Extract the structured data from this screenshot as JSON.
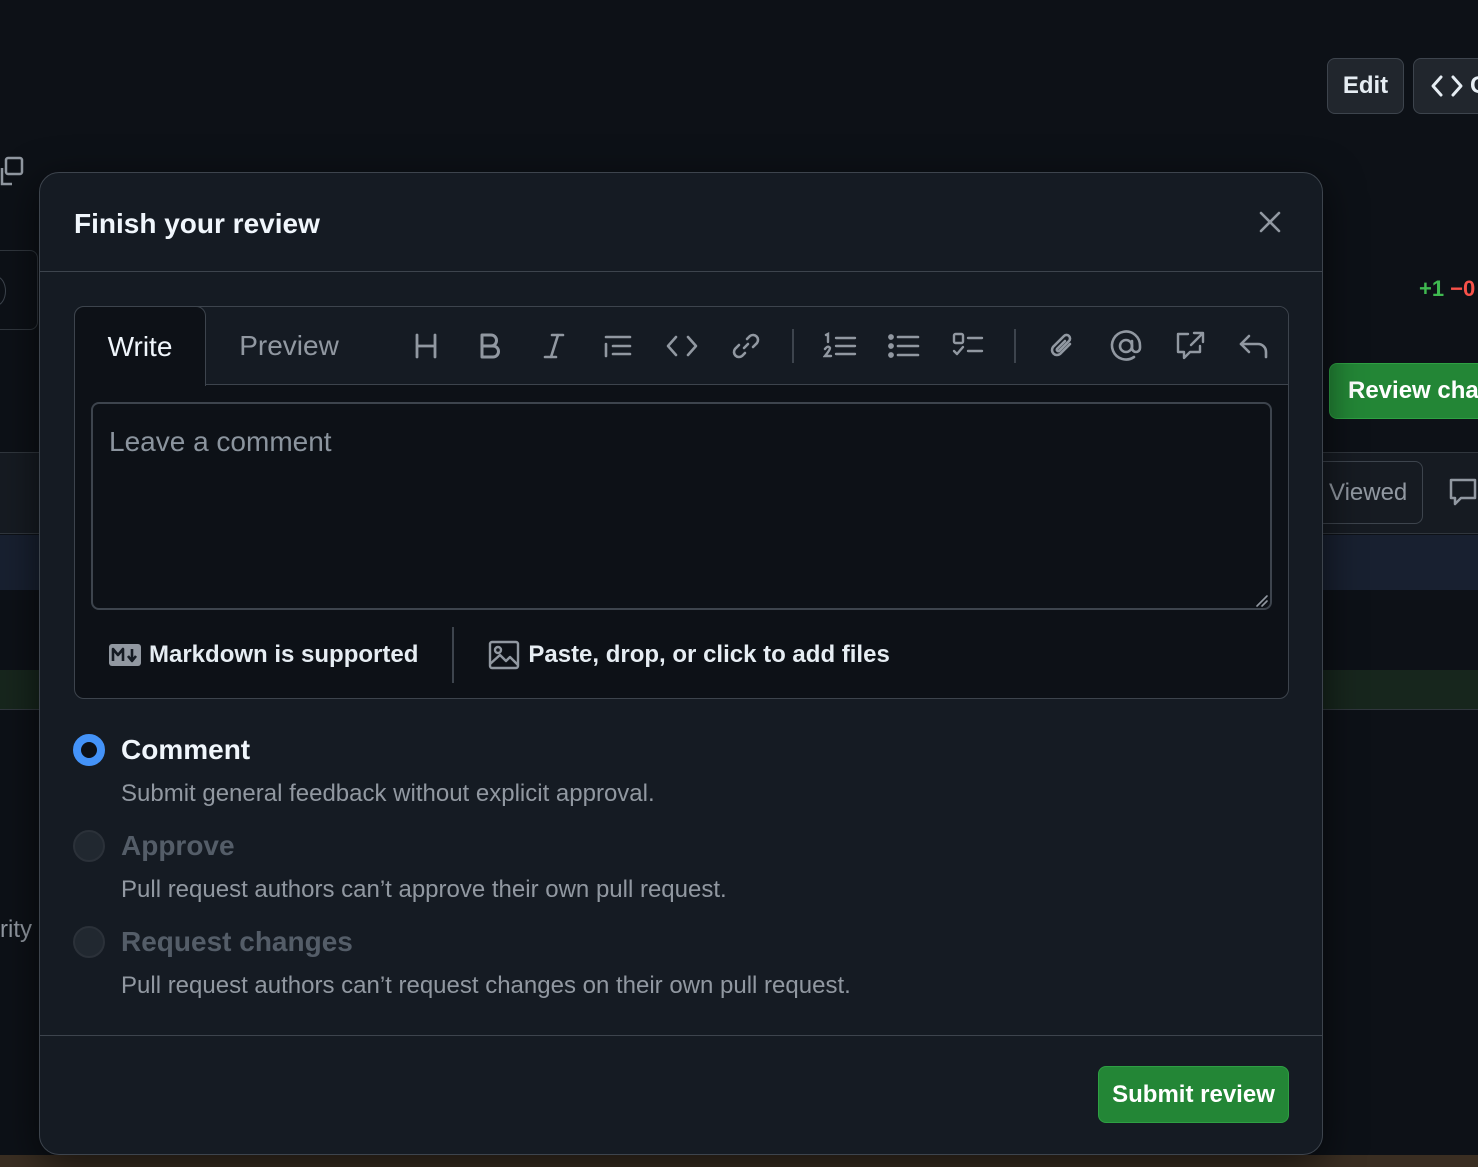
{
  "background": {
    "edit_label": "Edit",
    "code_label": "C",
    "diff_added": "+1",
    "diff_removed": "−0",
    "review_changes_label": "Review chan",
    "viewed_label": "Viewed",
    "side_text": "rity"
  },
  "dialog": {
    "title": "Finish your review",
    "close_icon": "x-icon",
    "tabs": {
      "write": "Write",
      "preview": "Preview"
    },
    "toolbar_icons": [
      "heading-icon",
      "bold-icon",
      "italic-icon",
      "quote-icon",
      "code-icon",
      "link-icon",
      "ordered-list-icon",
      "unordered-list-icon",
      "task-list-icon",
      "paperclip-icon",
      "mention-icon",
      "cross-reference-icon",
      "reply-icon"
    ],
    "comment": {
      "value": "",
      "placeholder": "Leave a comment"
    },
    "markdown_note": "Markdown is supported",
    "files_note": "Paste, drop, or click to add files",
    "options": [
      {
        "label": "Comment",
        "description": "Submit general feedback without explicit approval.",
        "checked": true,
        "disabled": false
      },
      {
        "label": "Approve",
        "description": "Pull request authors can’t approve their own pull request.",
        "checked": false,
        "disabled": true
      },
      {
        "label": "Request changes",
        "description": "Pull request authors can’t request changes on their own pull request.",
        "checked": false,
        "disabled": true
      }
    ],
    "submit_label": "Submit review"
  },
  "colors": {
    "page_bg": "#0d1117",
    "dialog_bg": "#151b23",
    "border": "#3d444d",
    "accent_blue": "#4493f8",
    "primary_green": "#238636",
    "diff_green": "#3fb950",
    "diff_red": "#f85149"
  }
}
